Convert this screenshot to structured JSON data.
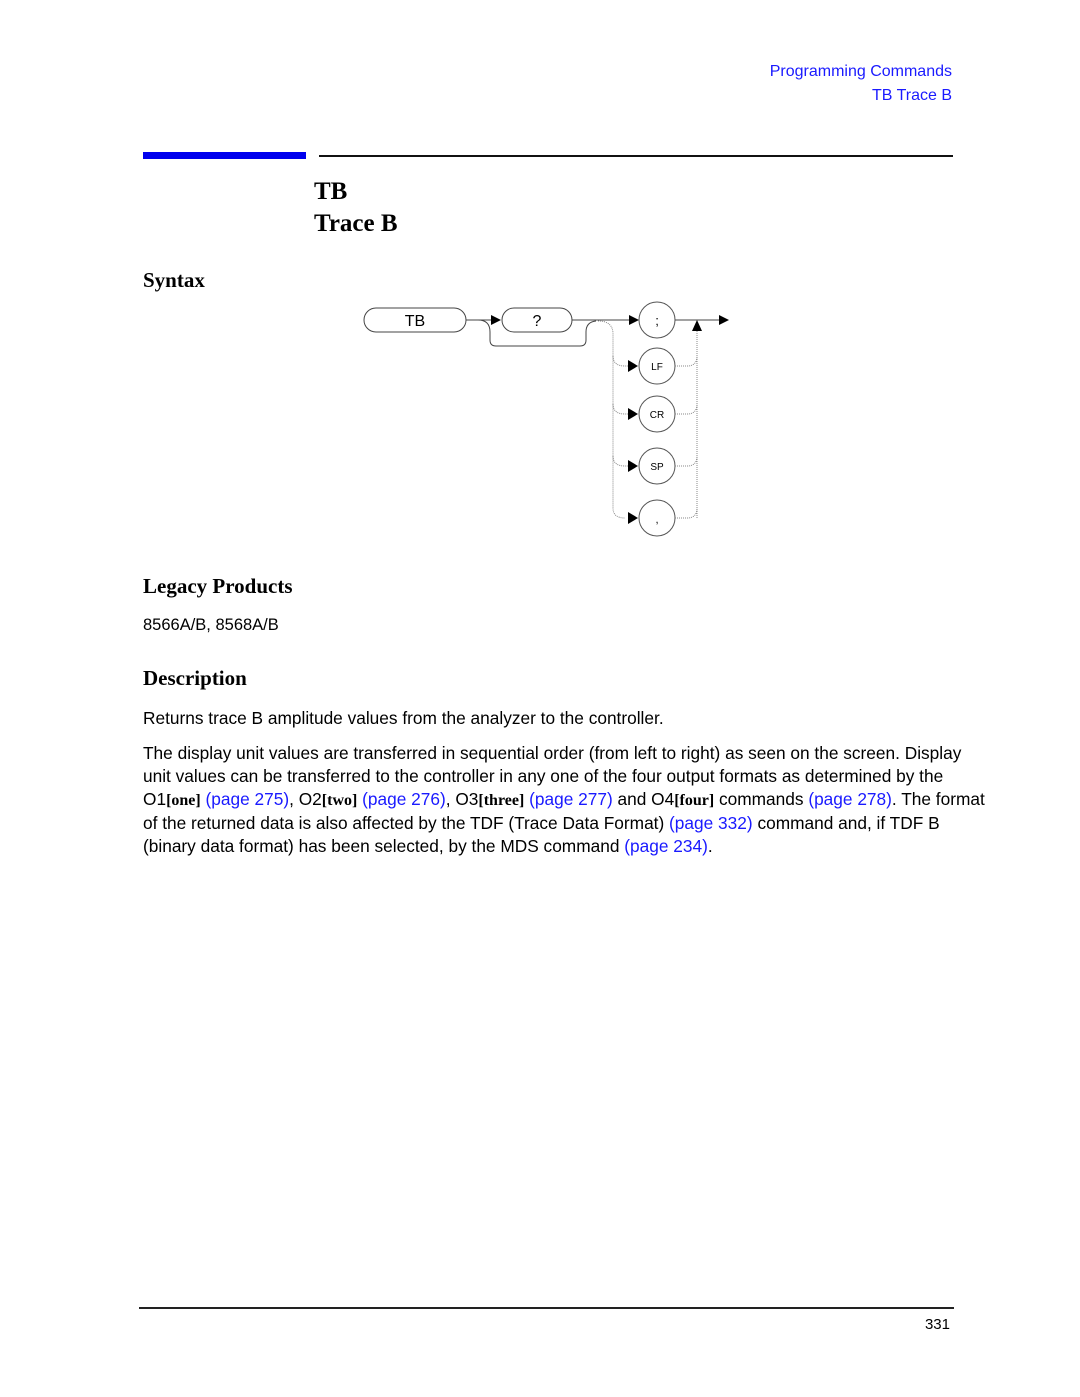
{
  "header": {
    "section": "Programming Commands",
    "topic": "TB Trace B"
  },
  "title": {
    "mnemonic": "TB",
    "name": "Trace B"
  },
  "syntax": {
    "heading": "Syntax",
    "diagram": {
      "command_node": "TB",
      "query_node": "?",
      "terminators": [
        ";",
        "LF",
        "CR",
        "SP",
        ","
      ]
    }
  },
  "legacy": {
    "heading": "Legacy Products",
    "products": "8566A/B, 8568A/B"
  },
  "description": {
    "heading": "Description",
    "para1": "Returns trace B amplitude values from the analyzer to the controller.",
    "para2": {
      "t1": "The display unit values are transferred in sequential order (from left to right) as seen on the screen. Display unit values can be transferred to the controller in any one of the four output formats as determined by the O1",
      "o1": "[one]",
      "link1": "(page 275)",
      "t2": ", O2",
      "o2": "[two]",
      "link2": "(page 276)",
      "t3": ", O3",
      "o3": "[three]",
      "link3": "(page 277)",
      "t4": " and O4",
      "o4": "[four]",
      "t5": " commands ",
      "link4": "(page 278)",
      "t6": ". The format of the returned data is also affected by the TDF (Trace Data Format) ",
      "link5": "(page 332)",
      "t7": " command and, if TDF B (binary data format) has been selected, by the MDS command ",
      "link6": "(page 234)",
      "t8": "."
    }
  },
  "footer": {
    "page_number": "331"
  }
}
